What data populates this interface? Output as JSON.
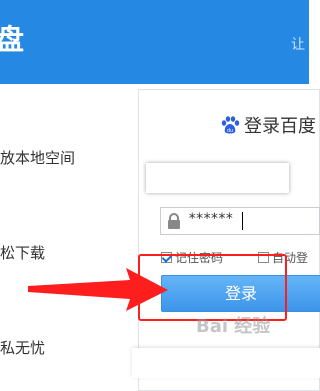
{
  "header": {
    "logo": "盘",
    "nav": "让"
  },
  "features": [
    {
      "text": "放本地空间"
    },
    {
      "text": "松下载"
    },
    {
      "text": "私无忧"
    }
  ],
  "login": {
    "title": "登录百度",
    "password_value": "******",
    "remember_label": "记住密码",
    "remember_checked": true,
    "auto_login_label": "自动登",
    "submit_label": "登录"
  },
  "watermark": "Bai 经验",
  "colors": {
    "header": "#2589e4",
    "button": "#3d95ea",
    "highlight": "#ff1e1e"
  }
}
